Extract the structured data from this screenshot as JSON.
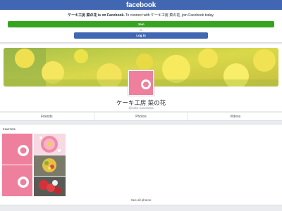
{
  "header": {
    "logo": "facebook"
  },
  "promo": {
    "page_name_bold": "ケーキ工房 菜の花 is on Facebook.",
    "message": " To connect with ケーキ工房 菜の花, join Facebook today.",
    "join_label": "Join",
    "or_label": "or",
    "login_label": "Log In"
  },
  "profile": {
    "name": "ケーキ工房 菜の花",
    "handle": "@cake.nanohana"
  },
  "tabs": [
    {
      "label": "Friends"
    },
    {
      "label": "Photos"
    },
    {
      "label": "Videos"
    }
  ],
  "photos": {
    "section_title": "PHOTOS",
    "see_all": "See all photos"
  },
  "colors": {
    "brand": "#4267b2",
    "join": "#36a420",
    "logo_pink": "#ee7f9d"
  }
}
